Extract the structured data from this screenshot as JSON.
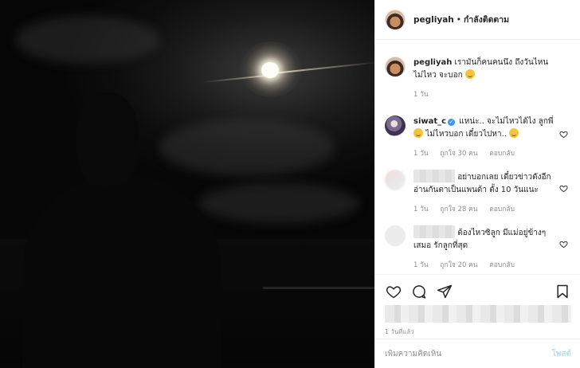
{
  "post": {
    "username": "pegliyah",
    "separator": "•",
    "follow_label": "กำลังติดตาม"
  },
  "caption": {
    "username": "pegliyah",
    "text": "เรามันก็คนคนนึง ถึงวันไหนไม่ไหว จะบอก",
    "time": "1 วัน"
  },
  "comments": [
    {
      "username": "siwat_c",
      "verified": true,
      "text": "แหน่ะ.. จะไม่ไหวได้ไง ลูกพี่",
      "text2": " ไม่ไหวบอก เดี๋ยวไปหา..",
      "time": "1 วัน",
      "likes": "ถูกใจ 30 คน",
      "reply": "ตอบกลับ"
    },
    {
      "username": "",
      "text": "อย่าบอกเลย เดี๋ยวข่าวดังอีก อ่านกันตาเป็นแพนด้า ตั้ง 10 วันแนะ",
      "time": "1 วัน",
      "likes": "ถูกใจ 28 คน",
      "reply": "ตอบกลับ"
    },
    {
      "username": "",
      "text": "ต้องไหวซิลูก มีแม่อยู่ข้างๆเสมอ รักลูกที่สุด",
      "time": "1 วัน",
      "likes": "ถูกใจ 20 คน",
      "reply": "ตอบกลับ"
    }
  ],
  "footer": {
    "timestamp": "1 วันที่แล้ว",
    "add_comment_placeholder": "เพิ่มความคิดเห็น",
    "post_label": "โพสต์"
  },
  "icons": {
    "like": "heart-icon",
    "comment": "comment-icon",
    "share": "share-icon",
    "save": "bookmark-icon"
  },
  "colors": {
    "verified": "#3897f0",
    "post_button_disabled": "#b2dffc",
    "secondary_text": "#8e8e8e"
  }
}
